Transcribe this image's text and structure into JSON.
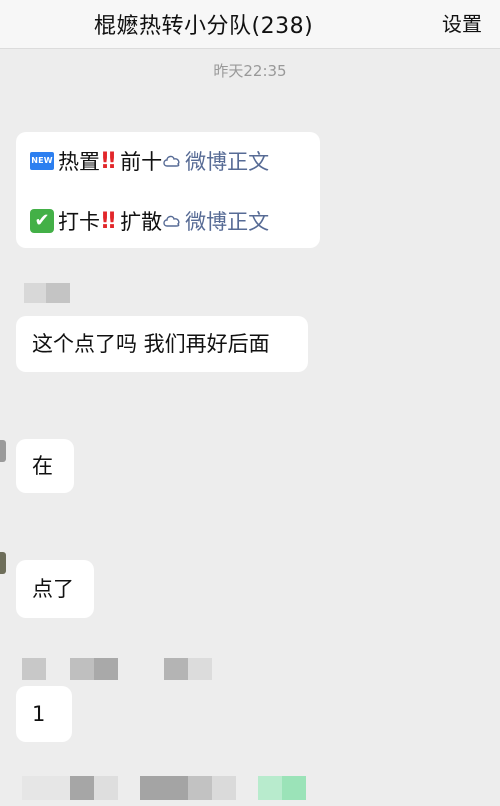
{
  "header": {
    "title": "棍嬷热转小分队(238)",
    "settings_label": "设置"
  },
  "timestamp": "昨天22:35",
  "messages": [
    {
      "lines": [
        {
          "badge": "NEW",
          "text": "热置",
          "mark": "!!",
          "text2": "前十",
          "link": "微博正文"
        },
        {
          "badge": "✔",
          "text": "打卡",
          "mark": "!!",
          "text2": "扩散",
          "link": "微博正文"
        }
      ]
    },
    {
      "text": "这个点了吗 我们再好后面"
    },
    {
      "text": "在"
    },
    {
      "text": "点了"
    },
    {
      "text": "1"
    }
  ],
  "colors": {
    "link": "#576b95",
    "new_badge": "#2c7ff0",
    "check_badge": "#43b047",
    "exclamation": "#e2262a"
  },
  "icons": [
    "cloud-icon",
    "new-badge-icon",
    "check-mark-icon",
    "double-exclamation-icon"
  ]
}
